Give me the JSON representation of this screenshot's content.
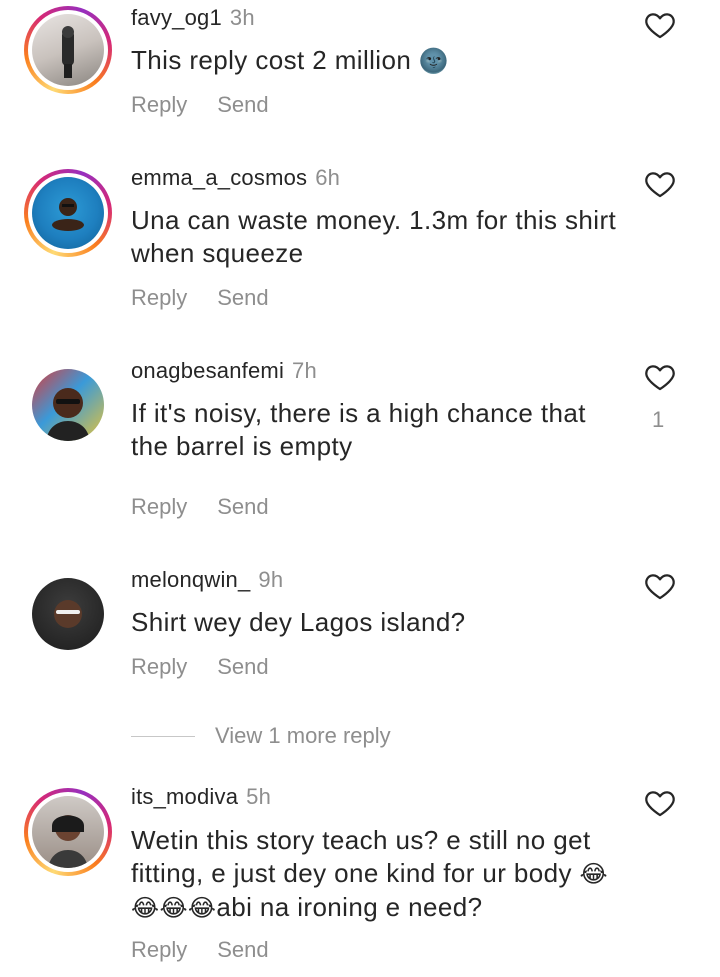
{
  "comments": [
    {
      "username": "favy_og1",
      "time": "3h",
      "text": "This reply cost 2 million",
      "emoji": "🌚",
      "reply_label": "Reply",
      "send_label": "Send",
      "likes": ""
    },
    {
      "username": "emma_a_cosmos",
      "time": "6h",
      "text": "Una can waste money. 1.3m for this shirt when squeeze",
      "reply_label": "Reply",
      "send_label": "Send",
      "likes": ""
    },
    {
      "username": "onagbesanfemi",
      "time": "7h",
      "text": "If it's noisy, there is a high chance that the barrel is empty",
      "reply_label": "Reply",
      "send_label": "Send",
      "likes": "1"
    },
    {
      "username": "melonqwin_",
      "time": "9h",
      "text": "Shirt wey dey Lagos island?",
      "reply_label": "Reply",
      "send_label": "Send",
      "likes": ""
    },
    {
      "username": "its_modiva",
      "time": "5h",
      "text_line1": "Wetin this story teach us? e still no get fitting, e just dey one kind for ur body",
      "emojis": "😂😂😂😂",
      "text_line2": "abi na ironing e need?",
      "reply_label": "Reply",
      "send_label": "Send",
      "likes": ""
    }
  ],
  "view_more": "View 1 more reply",
  "colors": {
    "text": "#262626",
    "muted": "#8e8e8e",
    "story_ring": [
      "#feda75",
      "#fa7e1e",
      "#d62976",
      "#962fbf"
    ]
  },
  "icons": {
    "like": "heart-outline-icon"
  }
}
